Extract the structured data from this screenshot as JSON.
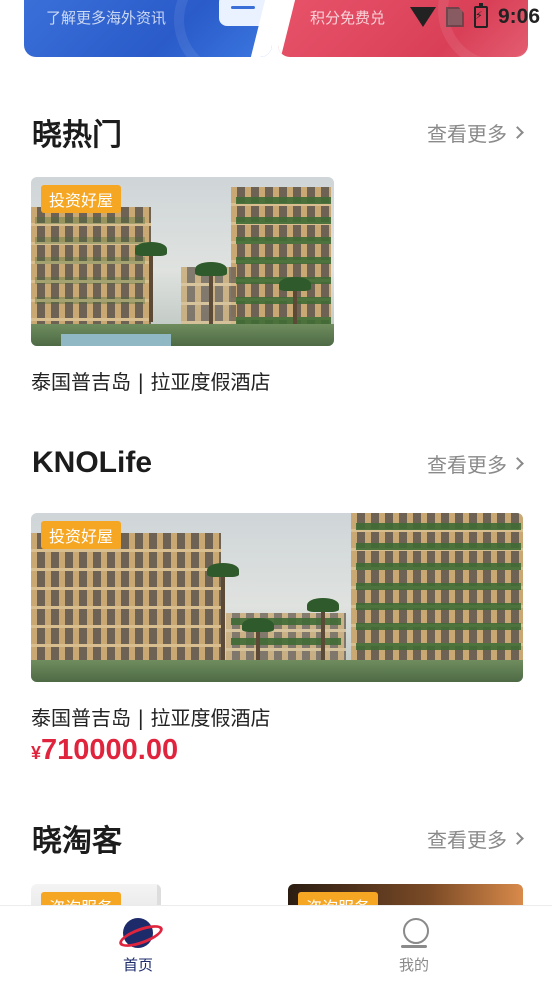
{
  "status_bar": {
    "time": "9:06"
  },
  "banners": [
    {
      "text": "了解更多海外资讯",
      "color": "#2a5bc9"
    },
    {
      "text": "积分免费兑",
      "color": "#d94058"
    }
  ],
  "sections": {
    "hot": {
      "title": "晓热门",
      "more_label": "查看更多",
      "cards": [
        {
          "tag": "投资好屋",
          "caption": "泰国普吉岛 | 拉亚度假酒店"
        }
      ]
    },
    "knolife": {
      "title": "KNOLife",
      "more_label": "查看更多",
      "cards": [
        {
          "tag": "投资好屋",
          "caption": "泰国普吉岛 | 拉亚度假酒店",
          "currency": "¥",
          "price": "710000.00"
        }
      ]
    },
    "taoke": {
      "title": "晓淘客",
      "more_label": "查看更多",
      "cards": [
        {
          "tag": "咨询服务"
        },
        {
          "tag": "咨询服务"
        }
      ]
    }
  },
  "bottom_nav": {
    "items": [
      {
        "label": "首页",
        "icon": "planet-icon",
        "active": true
      },
      {
        "label": "我的",
        "icon": "person-icon",
        "active": false
      }
    ]
  },
  "colors": {
    "accent": "#e0243d",
    "nav_active": "#1d2b6b",
    "tag": "#f5a623"
  }
}
